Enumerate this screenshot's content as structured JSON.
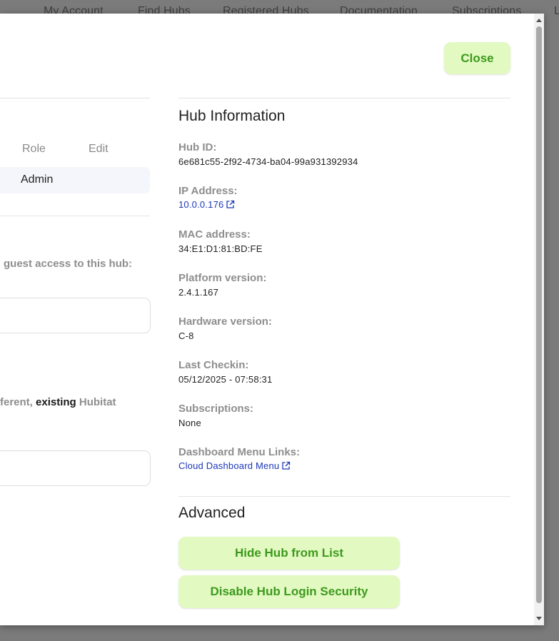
{
  "nav": {
    "items": [
      "My Account",
      "Find Hubs",
      "Registered Hubs",
      "Documentation",
      "Subscriptions",
      "L"
    ]
  },
  "modal": {
    "close_label": "Close",
    "users_table": {
      "col_role": "Role",
      "col_edit": "Edit",
      "rows": [
        {
          "role": "Admin"
        }
      ]
    },
    "guest_access_label": "guest access to this hub:",
    "existing_hub_label": {
      "prefix": "ferent, ",
      "strong": "existing",
      "suffix": " Hubitat"
    },
    "hub_info": {
      "title": "Hub Information",
      "hub_id_label": "Hub ID:",
      "hub_id_value": "6e681c55-2f92-4734-ba04-99a931392934",
      "ip_label": "IP Address:",
      "ip_value": "10.0.0.176",
      "mac_label": "MAC address:",
      "mac_value": "34:E1:D1:81:BD:FE",
      "platform_label": "Platform version:",
      "platform_value": "2.4.1.167",
      "hardware_label": "Hardware version:",
      "hardware_value": "C-8",
      "checkin_label": "Last Checkin:",
      "checkin_value": "05/12/2025 - 07:58:31",
      "subs_label": "Subscriptions:",
      "subs_value": "None",
      "dash_label": "Dashboard Menu Links:",
      "dash_value": "Cloud Dashboard Menu"
    },
    "advanced": {
      "title": "Advanced",
      "hide_label": "Hide Hub from List",
      "disable_label": "Disable Hub Login Security"
    }
  },
  "colors": {
    "button_bg": "#e2f9c1",
    "button_text": "#3d9a1e",
    "link": "#1c37b8",
    "overlay": "#7b7b7b"
  }
}
